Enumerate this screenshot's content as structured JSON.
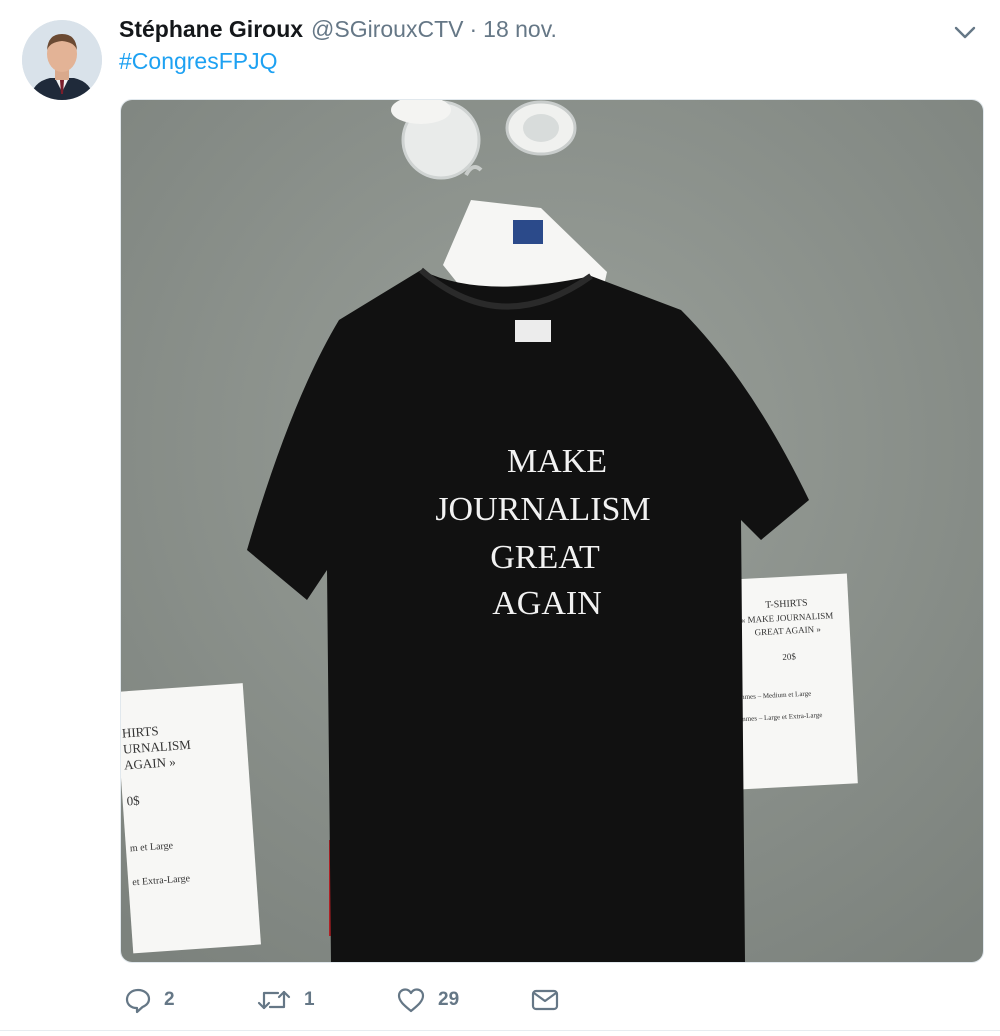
{
  "tweet": {
    "author_name": "Stéphane Giroux",
    "author_handle": "@SGirouxCTV",
    "separator": "·",
    "timestamp": "18 nov.",
    "hashtag": "#CongresFPJQ",
    "image": {
      "shirt_lines": [
        "MAKE",
        "JOURNALISM",
        "GREAT",
        "AGAIN"
      ],
      "right_sign_lines": [
        "T-SHIRTS",
        "« MAKE JOURNALISM",
        "GREAT AGAIN »",
        "20$",
        "mmes – Medium et Large",
        "mmes – Large et Extra-Large"
      ],
      "left_sign_lines": [
        "HIRTS",
        "URNALISM",
        "AGAIN »",
        "0$",
        "m et Large",
        "et Extra-Large"
      ]
    }
  },
  "actions": {
    "reply_count": "2",
    "retweet_count": "1",
    "like_count": "29"
  },
  "icons": {
    "reply": "reply-icon",
    "retweet": "retweet-icon",
    "like": "heart-icon",
    "message": "envelope-icon",
    "menu": "chevron-down-icon"
  },
  "colors": {
    "link": "#1da1f2",
    "secondary_text": "#657786"
  }
}
